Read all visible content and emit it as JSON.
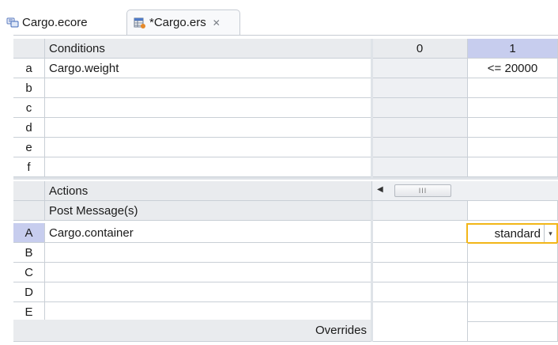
{
  "tabs": [
    {
      "label": "Cargo.ecore",
      "icon": "ecore-model-icon",
      "active": false
    },
    {
      "label": "*Cargo.ers",
      "icon": "rulesheet-icon",
      "active": true,
      "close": "✕"
    }
  ],
  "grid": {
    "column_headers": [
      "0",
      "1"
    ],
    "conditions": {
      "header": "Conditions",
      "rows": [
        {
          "letter": "a",
          "name": "Cargo.weight",
          "col0": "",
          "col1": "<= 20000"
        },
        {
          "letter": "b",
          "name": "",
          "col0": "",
          "col1": ""
        },
        {
          "letter": "c",
          "name": "",
          "col0": "",
          "col1": ""
        },
        {
          "letter": "d",
          "name": "",
          "col0": "",
          "col1": ""
        },
        {
          "letter": "e",
          "name": "",
          "col0": "",
          "col1": ""
        },
        {
          "letter": "f",
          "name": "",
          "col0": "",
          "col1": ""
        }
      ]
    },
    "actions": {
      "header": "Actions",
      "post_message_label": "Post Message(s)",
      "rows": [
        {
          "letter": "A",
          "name": "Cargo.container",
          "col0": "",
          "col1": "standard",
          "selected": true
        },
        {
          "letter": "B",
          "name": "",
          "col0": "",
          "col1": ""
        },
        {
          "letter": "C",
          "name": "",
          "col0": "",
          "col1": ""
        },
        {
          "letter": "D",
          "name": "",
          "col0": "",
          "col1": ""
        },
        {
          "letter": "E",
          "name": "",
          "col0": "",
          "col1": ""
        }
      ]
    },
    "overrides_label": "Overrides",
    "scrollbar": {
      "arrow": "◀",
      "thumb_grip": "III"
    },
    "combo_arrow": "▾"
  },
  "colors": {
    "header_bg": "#e9ebee",
    "selection_bg": "#c7cdee",
    "combo_focus_border": "#f2b618",
    "grid_line": "#c9cfd6"
  }
}
